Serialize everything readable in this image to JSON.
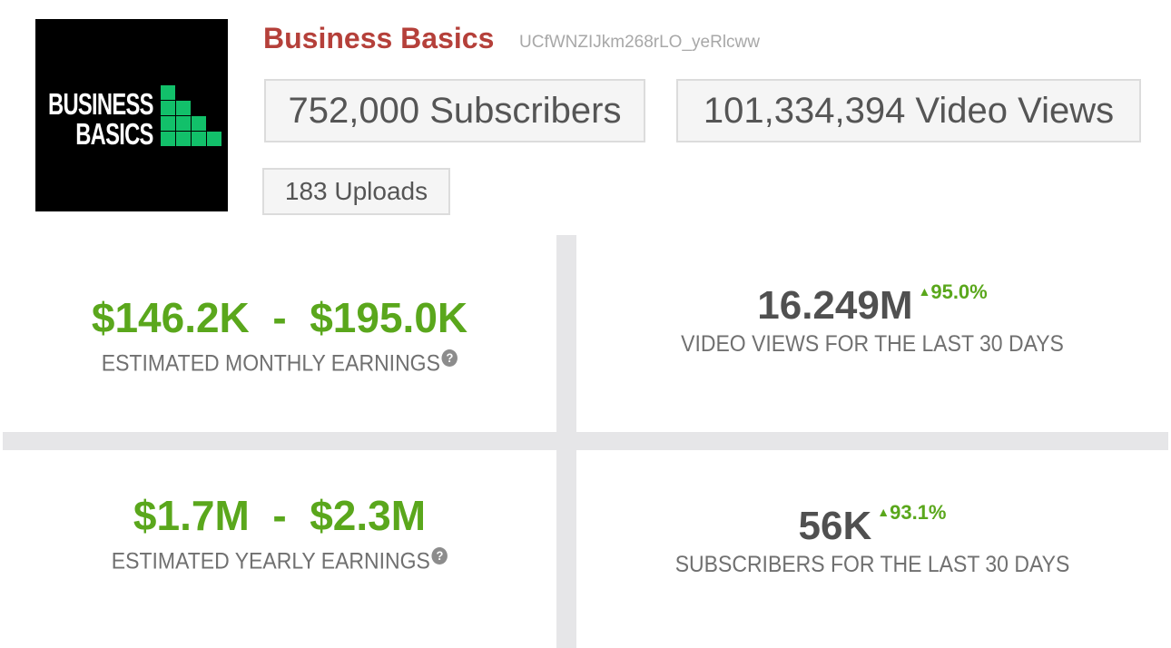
{
  "channel": {
    "logo_text": [
      "BUSINESS",
      "BASICS"
    ],
    "logo_accent_color": "#12c06a",
    "title": "Business Basics",
    "id": "UCfWNZIJkm268rLO_yeRlcww",
    "subscribers": "752,000 Subscribers",
    "video_views": "101,334,394 Video Views",
    "uploads": "183 Uploads"
  },
  "earnings": {
    "monthly_value": "$146.2K  -  $195.0K",
    "monthly_label": "ESTIMATED MONTHLY EARNINGS",
    "yearly_value": "$1.7M  -  $2.3M",
    "yearly_label": "ESTIMATED YEARLY EARNINGS",
    "help_icon": "?"
  },
  "metrics": {
    "views_30d_value": "16.249M",
    "views_30d_change": "95.0%",
    "views_30d_label": "VIDEO VIEWS FOR THE LAST 30 DAYS",
    "subs_30d_value": "56K",
    "subs_30d_change": "93.1%",
    "subs_30d_label": "SUBSCRIBERS FOR THE LAST 30 DAYS",
    "change_arrow": "▲"
  },
  "colors": {
    "title": "#b5403a",
    "earnings": "#5aa71c",
    "change_up": "#5aa71c",
    "divider": "#e6e6e8"
  }
}
